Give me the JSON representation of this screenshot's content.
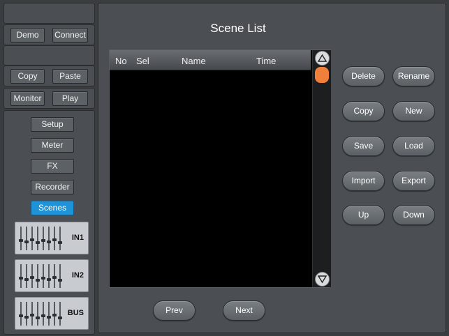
{
  "sidebar": {
    "row1": {
      "demo_label": "Demo",
      "connect_label": "Connect"
    },
    "row2": {
      "copy_label": "Copy",
      "paste_label": "Paste"
    },
    "row3": {
      "monitor_label": "Monitor",
      "play_label": "Play"
    },
    "nav": [
      {
        "label": "Setup",
        "active": false
      },
      {
        "label": "Meter",
        "active": false
      },
      {
        "label": "FX",
        "active": false
      },
      {
        "label": "Recorder",
        "active": false
      },
      {
        "label": "Scenes",
        "active": true
      }
    ],
    "channels": [
      {
        "label": "IN1"
      },
      {
        "label": "IN2"
      },
      {
        "label": "BUS"
      }
    ]
  },
  "main": {
    "title": "Scene List",
    "columns": {
      "no": "No",
      "sel": "Sel",
      "name": "Name",
      "time": "Time"
    },
    "rows": [],
    "actions": {
      "delete": "Delete",
      "rename": "Rename",
      "copy": "Copy",
      "new": "New",
      "save": "Save",
      "load": "Load",
      "import": "Import",
      "export": "Export",
      "up": "Up",
      "down": "Down"
    },
    "pager": {
      "prev": "Prev",
      "next": "Next"
    }
  },
  "colors": {
    "active_nav": "#1e93d8",
    "scroll_thumb": "#f07f3c"
  }
}
